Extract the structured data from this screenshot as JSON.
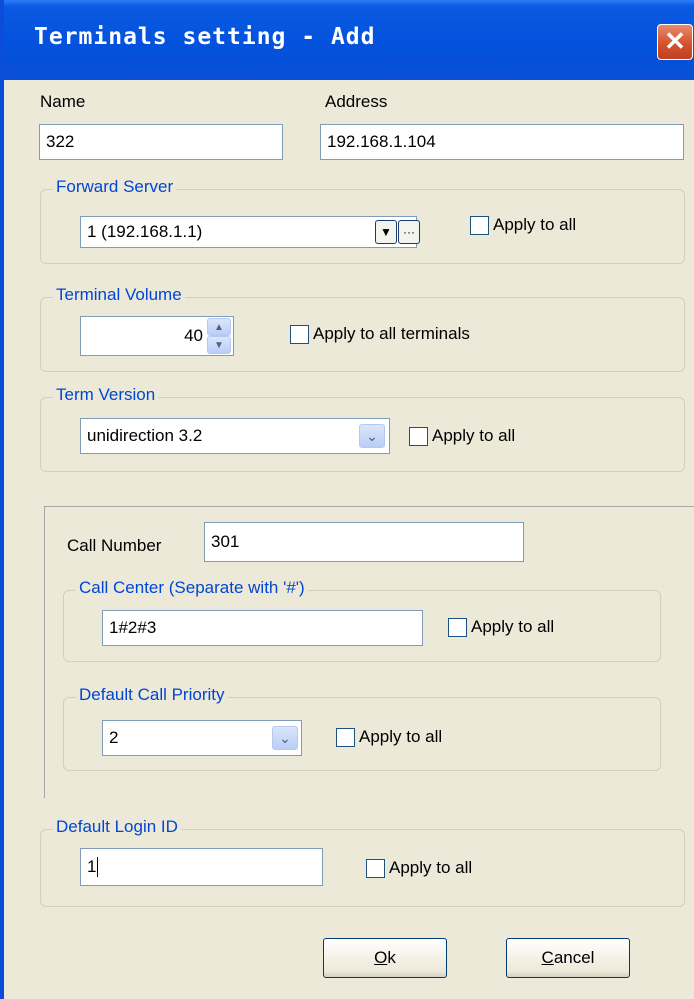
{
  "window": {
    "title": "Terminals setting - Add",
    "close_glyph": "✕"
  },
  "name": {
    "label": "Name",
    "value": "322"
  },
  "address": {
    "label": "Address",
    "value": "192.168.1.104"
  },
  "forward_server": {
    "legend": "Forward Server",
    "value": "1 (192.168.1.1)",
    "browse_glyph": "···",
    "apply_label": "Apply to all"
  },
  "terminal_volume": {
    "legend": "Terminal Volume",
    "value": "40",
    "apply_label": "Apply to all terminals"
  },
  "term_version": {
    "legend": "Term Version",
    "value": "unidirection 3.2",
    "apply_label": "Apply to all"
  },
  "call_number": {
    "label": "Call Number",
    "value": "301"
  },
  "call_center": {
    "legend": "Call Center  (Separate with '#')",
    "value": "1#2#3",
    "apply_label": "Apply to all"
  },
  "default_call_priority": {
    "legend": "Default Call Priority",
    "value": "2",
    "apply_label": "Apply to all"
  },
  "default_login_id": {
    "legend": "Default Login ID",
    "value": "1",
    "apply_label": "Apply to all"
  },
  "buttons": {
    "ok_mnemonic": "O",
    "ok_rest": "k",
    "cancel_mnemonic": "C",
    "cancel_rest": "ancel"
  }
}
